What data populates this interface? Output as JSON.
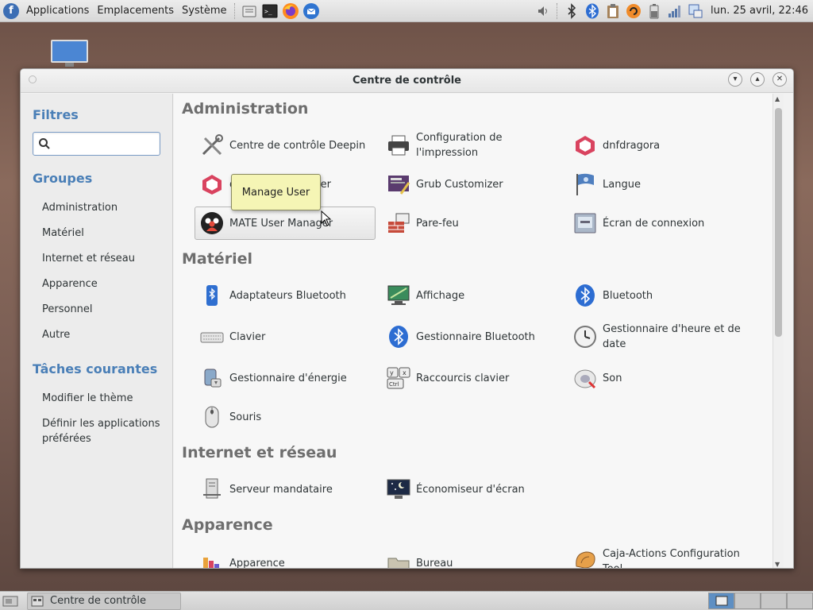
{
  "top_panel": {
    "menus": [
      "Applications",
      "Emplacements",
      "Système"
    ],
    "clock": "lun. 25 avril, 22:46"
  },
  "window": {
    "title": "Centre de contrôle"
  },
  "sidebar": {
    "filters_heading": "Filtres",
    "search_placeholder": "",
    "groups_heading": "Groupes",
    "groups": [
      "Administration",
      "Matériel",
      "Internet et réseau",
      "Apparence",
      "Personnel",
      "Autre"
    ],
    "tasks_heading": "Tâches courantes",
    "tasks": [
      "Modifier le thème",
      "Définir les applications préférées"
    ]
  },
  "sections": {
    "administration": {
      "title": "Administration",
      "items": [
        "Centre de contrôle Deepin",
        "Configuration de l'impression",
        "dnfdragora",
        "dnfdragora-updater",
        "Grub Customizer",
        "Langue",
        "MATE User Manager",
        "Pare-feu",
        "Écran de connexion"
      ]
    },
    "materiel": {
      "title": "Matériel",
      "items": [
        "Adaptateurs Bluetooth",
        "Affichage",
        "Bluetooth",
        "Clavier",
        "Gestionnaire Bluetooth",
        "Gestionnaire d'heure et de date",
        "Gestionnaire d'énergie",
        "Raccourcis clavier",
        "Son",
        "Souris"
      ]
    },
    "internet": {
      "title": "Internet et réseau",
      "items": [
        "Serveur mandataire",
        "Économiseur d'écran"
      ]
    },
    "apparence": {
      "title": "Apparence",
      "items": [
        "Apparence",
        "Bureau",
        "Caja-Actions Configuration Tool"
      ]
    }
  },
  "tooltip": "Manage User",
  "taskbar": {
    "task_label": "Centre de contrôle"
  },
  "colors": {
    "accent": "#4a7fb7",
    "tooltip_bg": "#f5f5b5"
  }
}
